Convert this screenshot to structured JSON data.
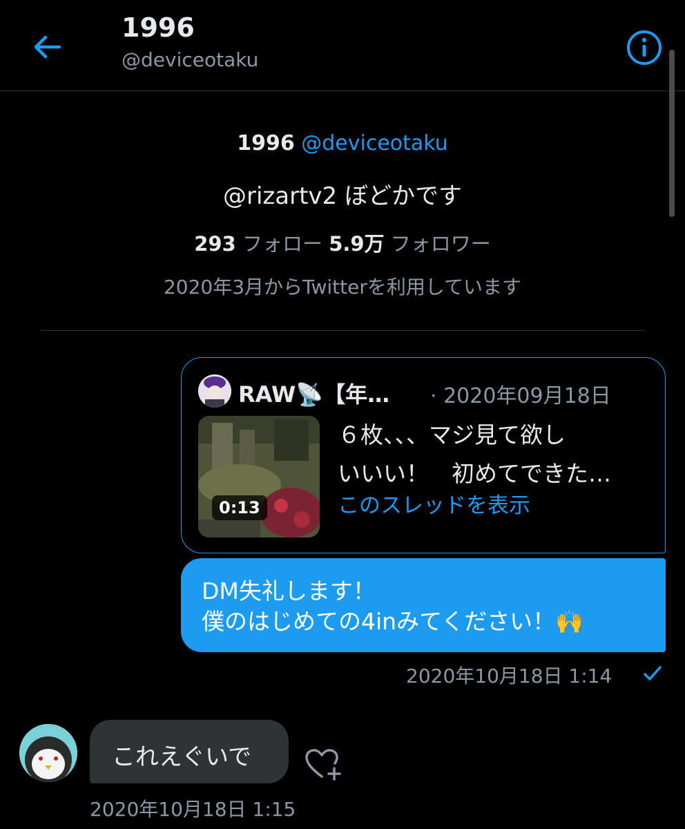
{
  "header": {
    "title": "1996",
    "handle": "@deviceotaku"
  },
  "profile": {
    "name": "1996",
    "handle": "@deviceotaku",
    "bio": "@rizartv2 ぼどかです",
    "following_count": "293",
    "following_label": "フォロー",
    "followers_count": "5.9万",
    "followers_label": "フォロワー",
    "joined": "2020年3月からTwitterを利用しています"
  },
  "quoted_tweet": {
    "author": "RAW📡【年…",
    "date": "· 2020年09月18日",
    "video_duration": "0:13",
    "text_line1": "６枚、、、マジ見て欲し",
    "text_line2": "いいい！　初めてできた…",
    "thread_link": "このスレッドを表示"
  },
  "messages": {
    "sent_line1": "DM失礼します！",
    "sent_line2": "僕のはじめての4inみてください！🙌",
    "sent_time": "2020年10月18日 1:14",
    "received_text": "これえぐいで",
    "received_time": "2020年10月18日 1:15"
  },
  "colors": {
    "accent": "#1d9bf0",
    "background": "#000000",
    "muted_text": "#8b98a5",
    "received_bubble": "#2f3336"
  },
  "icons": {
    "back": "arrow-left-icon",
    "info": "info-icon",
    "read": "check-icon",
    "react": "heart-add-icon"
  }
}
